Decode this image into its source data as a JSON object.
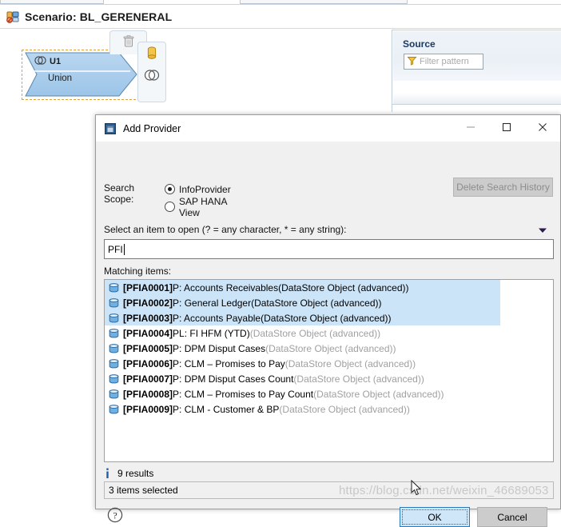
{
  "editor": {
    "scenario_icon": "scenario-icon",
    "scenario_title": "Scenario: BL_GERENERAL",
    "node": {
      "id_label": "U1",
      "type_label": "Union",
      "id_icon": "union-icon",
      "tools": {
        "delete_icon": "trash-icon",
        "provider_icon": "datastore-cylinder-icon",
        "union_icon": "union-icon"
      }
    },
    "source_panel": {
      "title": "Source",
      "filter_icon": "filter-funnel-icon",
      "filter_placeholder": "Filter pattern",
      "filter_value": ""
    }
  },
  "dialog": {
    "app_icon": "add-provider-icon",
    "title": "Add Provider",
    "window_buttons": {
      "minimize": "—",
      "maximize": "☐",
      "close": "✕",
      "minimize_icon": "minimize-icon",
      "maximize_icon": "maximize-icon",
      "close_icon": "close-icon"
    },
    "search_scope": {
      "label": "Search Scope:",
      "options": [
        {
          "label": "InfoProvider",
          "selected": true
        },
        {
          "label": "SAP HANA View",
          "selected": false
        }
      ]
    },
    "delete_search_history_label": "Delete Search History",
    "select_label": "Select an item to open (? = any character, * = any string):",
    "history_arrow_icon": "chevron-down-icon",
    "search": {
      "value": "PFI",
      "placeholder": ""
    },
    "matching_label": "Matching items:",
    "items": [
      {
        "icon": "datastore-icon",
        "id": "[PFIA0001]",
        "name": " P: Accounts Receivables ",
        "type": "(DataStore Object (advanced))",
        "selected": true
      },
      {
        "icon": "datastore-icon",
        "id": "[PFIA0002]",
        "name": " P: General Ledger ",
        "type": "(DataStore Object (advanced))",
        "selected": true
      },
      {
        "icon": "datastore-icon",
        "id": "[PFIA0003]",
        "name": " P: Accounts Payable ",
        "type": "(DataStore Object (advanced))",
        "selected": true
      },
      {
        "icon": "datastore-icon",
        "id": "[PFIA0004]",
        "name": " PL: FI HFM (YTD) ",
        "type": "(DataStore Object (advanced))",
        "selected": false
      },
      {
        "icon": "datastore-icon",
        "id": "[PFIA0005]",
        "name": " P: DPM Disput Cases ",
        "type": "(DataStore Object (advanced))",
        "selected": false
      },
      {
        "icon": "datastore-icon",
        "id": "[PFIA0006]",
        "name": " P: CLM – Promises to Pay ",
        "type": "(DataStore Object (advanced))",
        "selected": false
      },
      {
        "icon": "datastore-icon",
        "id": "[PFIA0007]",
        "name": " P: DPM Disput Cases Count ",
        "type": "(DataStore Object (advanced))",
        "selected": false
      },
      {
        "icon": "datastore-icon",
        "id": "[PFIA0008]",
        "name": " P: CLM – Promises to Pay Count ",
        "type": "(DataStore Object (advanced))",
        "selected": false
      },
      {
        "icon": "datastore-icon",
        "id": "[PFIA0009]",
        "name": " P: CLM - Customer & BP ",
        "type": "(DataStore Object (advanced))",
        "selected": false
      }
    ],
    "results_icon": "info-icon",
    "results_text": "9 results",
    "status_text": "3 items selected",
    "help_icon": "help-icon",
    "ok_label": "OK",
    "cancel_label": "Cancel"
  },
  "overlay": {
    "watermark": "https://blog.csdn.net/weixin_46689053",
    "cursor_icon": "mouse-pointer-icon"
  },
  "colors": {
    "selection_blue": "#cce4f7",
    "accent_blue": "#2a7ab9",
    "node_fill": "#a9cdee",
    "dashed_orange": "#e0a040",
    "disabled_gray": "#8d8d8d"
  }
}
